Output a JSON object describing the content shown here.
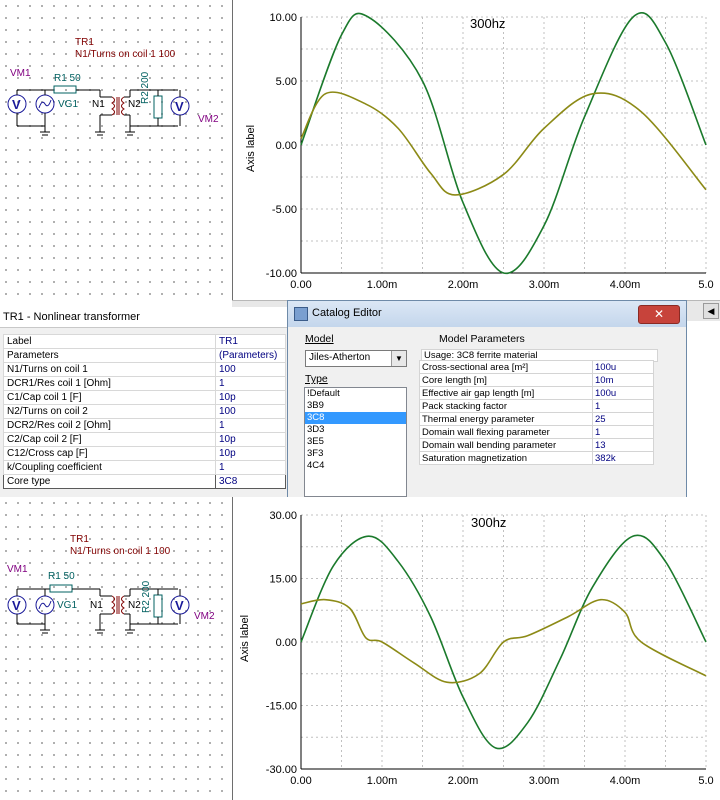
{
  "top": {
    "schematic": {
      "component": "TR1",
      "caption": "N1/Turns on coil 1 100",
      "vm1": "VM1",
      "r1": "R1 50",
      "vg1": "VG1",
      "n1": "N1",
      "n2": "N2",
      "r2": "R2 200",
      "vm2": "VM2"
    },
    "plot": {
      "annotation": "300hz",
      "ylabel": "Axis label",
      "yticks": [
        "10.00",
        "5.00",
        "0.00",
        "-5.00",
        "-10.00"
      ],
      "xticks": [
        "0.00",
        "1.00m",
        "2.00m",
        "3.00m",
        "4.00m",
        "5.0"
      ]
    }
  },
  "properties": {
    "title": "TR1 - Nonlinear transformer",
    "rows": [
      {
        "name": "Label",
        "value": "TR1"
      },
      {
        "name": "Parameters",
        "value": "(Parameters)"
      },
      {
        "name": "N1/Turns on coil 1",
        "value": "100"
      },
      {
        "name": "DCR1/Res coil 1 [Ohm]",
        "value": "1"
      },
      {
        "name": "C1/Cap coil 1  [F]",
        "value": "10p"
      },
      {
        "name": "N2/Turns on coil 2",
        "value": "100"
      },
      {
        "name": "DCR2/Res coil 2 [Ohm]",
        "value": "1"
      },
      {
        "name": "C2/Cap coil 2  [F]",
        "value": "10p"
      },
      {
        "name": "C12/Cross cap  [F]",
        "value": "10p"
      },
      {
        "name": "k/Coupling coefficient",
        "value": "1"
      },
      {
        "name": "Core type",
        "value": "3C8"
      }
    ]
  },
  "catalog": {
    "title": "Catalog Editor",
    "close": "✕",
    "model_label": "Model",
    "model_value": "Jiles-Atherton",
    "type_label": "Type",
    "types": [
      "!Default",
      "3B9",
      "3C8",
      "3D3",
      "3E5",
      "3F3",
      "4C4"
    ],
    "selected_type": "3C8",
    "params_label": "Model Parameters",
    "usage": "Usage: 3C8 ferrite material",
    "params": [
      {
        "name": "Cross-sectional area [m²]",
        "value": "100u"
      },
      {
        "name": "Core length [m]",
        "value": "10m"
      },
      {
        "name": "Effective air gap length [m]",
        "value": "100u"
      },
      {
        "name": "Pack stacking factor",
        "value": "1"
      },
      {
        "name": "Thermal energy parameter",
        "value": "25"
      },
      {
        "name": "Domain wall flexing parameter",
        "value": "1"
      },
      {
        "name": "Domain wall bending parameter",
        "value": "13"
      },
      {
        "name": "Saturation magnetization",
        "value": "382k"
      }
    ]
  },
  "bottom": {
    "schematic": {
      "component": "TR1",
      "caption": "N1/Turns on coil 1 100",
      "vm1": "VM1",
      "r1": "R1 50",
      "vg1": "VG1",
      "n1": "N1",
      "n2": "N2",
      "r2": "R2 200",
      "vm2": "VM2"
    },
    "plot": {
      "annotation": "300hz",
      "ylabel": "Axis label",
      "yticks": [
        "30.00",
        "15.00",
        "0.00",
        "-15.00",
        "-30.00"
      ],
      "xticks": [
        "0.00",
        "1.00m",
        "2.00m",
        "3.00m",
        "4.00m",
        "5.0"
      ]
    }
  },
  "colors": {
    "input_trace": "#1b7a2c",
    "output_trace": "#8c8a16",
    "grid": "#c0c0c0",
    "selection": "#3399ff"
  },
  "chart_data": [
    {
      "type": "line",
      "title": "300hz",
      "ylabel": "Axis label",
      "xlabel": "",
      "xlim": [
        0,
        0.005
      ],
      "ylim": [
        -10,
        10
      ],
      "series": [
        {
          "x": [
            0,
            0.0005,
            0.00083,
            0.0015,
            0.002,
            0.0025,
            0.003,
            0.0035,
            0.0041,
            0.0045,
            0.005
          ],
          "values": [
            0,
            8.6,
            10,
            5.0,
            -4.5,
            -10,
            -6.3,
            2.2,
            10,
            8.0,
            0
          ]
        },
        {
          "x": [
            0,
            0.0003,
            0.0008,
            0.0012,
            0.0016,
            0.0019,
            0.0025,
            0.003,
            0.0036,
            0.0042,
            0.005
          ],
          "values": [
            0.5,
            4.0,
            3.2,
            1.3,
            -2.2,
            -3.9,
            -2.3,
            1.3,
            4.0,
            2.6,
            -3.5
          ]
        }
      ]
    },
    {
      "type": "line",
      "title": "300hz",
      "ylabel": "Axis label",
      "xlabel": "",
      "xlim": [
        0,
        0.005
      ],
      "ylim": [
        -30,
        30
      ],
      "series": [
        {
          "x": [
            0,
            0.0004,
            0.00083,
            0.0012,
            0.0016,
            0.002,
            0.0024,
            0.0028,
            0.0032,
            0.0036,
            0.0041,
            0.0045,
            0.005
          ],
          "values": [
            0,
            18,
            25,
            19,
            6,
            -13,
            -25,
            -19,
            -4,
            13,
            25,
            19,
            0
          ]
        },
        {
          "x": [
            0,
            0.0003,
            0.0006,
            0.0008,
            0.001,
            0.0014,
            0.0018,
            0.0022,
            0.0025,
            0.0028,
            0.0033,
            0.0037,
            0.004,
            0.0042,
            0.005
          ],
          "values": [
            9,
            10,
            8,
            1,
            0,
            -5,
            -9.5,
            -7.5,
            0,
            1.5,
            6,
            10,
            7,
            0,
            -8
          ]
        }
      ]
    }
  ]
}
